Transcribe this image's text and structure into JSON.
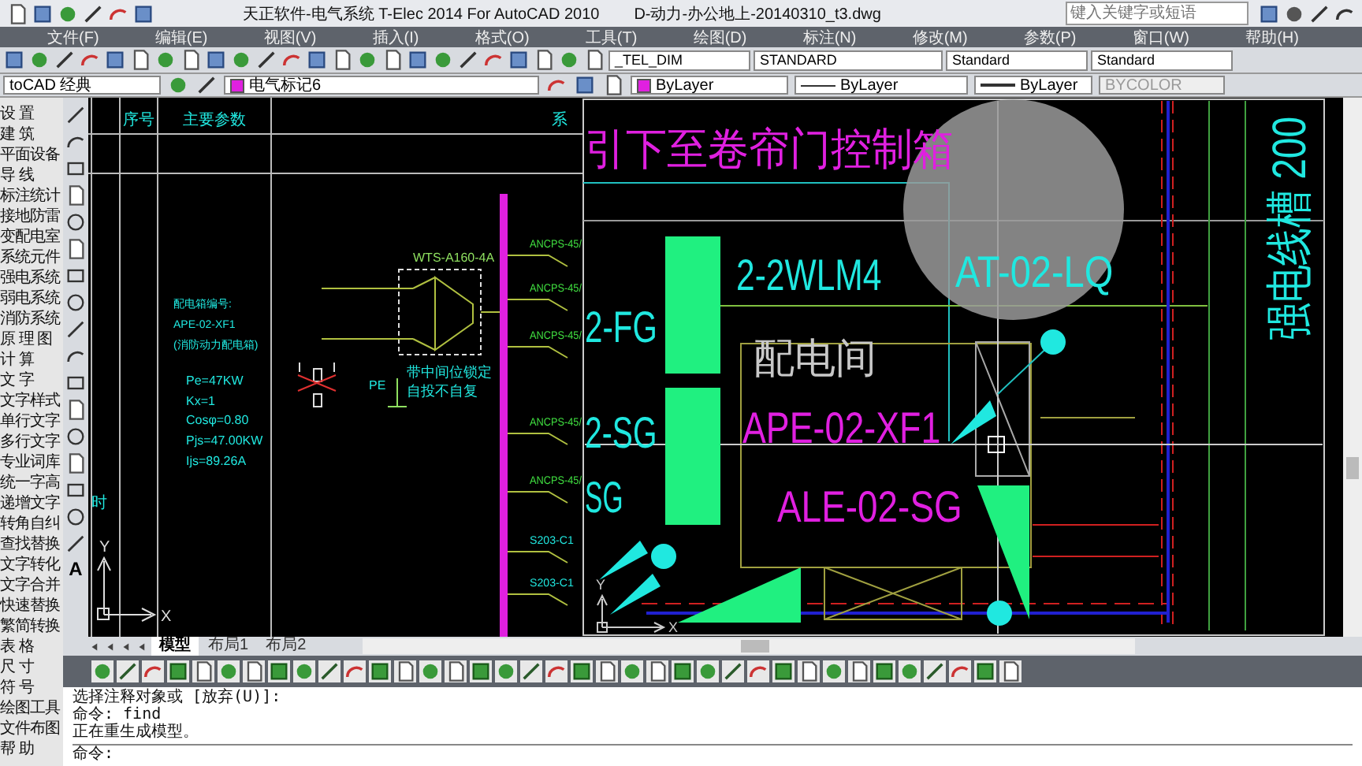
{
  "title_bar": {
    "title": "天正软件-电气系统 T-Elec 2014  For AutoCAD 2010",
    "file": "D-动力-办公地上-20140310_t3.dwg",
    "search": {
      "placeholder": "键入关键字或短语"
    }
  },
  "menu_bar": [
    "文件(F)",
    "编辑(E)",
    "视图(V)",
    "插入(I)",
    "格式(O)",
    "工具(T)",
    "绘图(D)",
    "标注(N)",
    "修改(M)",
    "参数(P)",
    "窗口(W)",
    "帮助(H)"
  ],
  "styles_toolbar": {
    "text_style": "_TEL_DIM",
    "dim_style": "STANDARD",
    "table_style": "Standard",
    "multileader_style": "Standard"
  },
  "properties_bar": {
    "workspace": "toCAD 经典",
    "layer": "电气标记6",
    "color_control": "ByLayer",
    "linetype": "ByLayer",
    "lineweight": "ByLayer",
    "plot_style": "BYCOLOR"
  },
  "side_menu": [
    "设 置",
    "建 筑",
    "平面设备",
    "导 线",
    "标注统计",
    "接地防雷",
    "变配电室",
    "系统元件",
    "强电系统",
    "弱电系统",
    "消防系统",
    "原 理 图",
    "计 算",
    "文 字",
    "文字样式",
    "单行文字",
    "多行文字",
    "专业词库",
    "统一字高",
    "递增文字",
    "转角自纠",
    "查找替换",
    "文字转化",
    "文字合并",
    "快速替换",
    "繁简转换",
    "表 格",
    "尺 寸",
    "符 号",
    "绘图工具",
    "文件布图",
    "帮 助"
  ],
  "draw_tools": {
    "text_tool": "A"
  },
  "drawing": {
    "table_headers": [
      "序号",
      "主要参数",
      "系"
    ],
    "panel_info": [
      "配电箱编号:",
      "APE-02-XF1",
      "(消防动力配电箱)"
    ],
    "params": [
      "Pe=47KW",
      "Kx=1",
      "Cosφ=0.80",
      "Pjs=47.00KW",
      "Ijs=89.26A"
    ],
    "switch_label": "WTS-A160-4A",
    "switch_note": [
      "带中间位锁定",
      "自投不自复"
    ],
    "pe_label": "PE",
    "circuits": [
      "ANCPS-45/",
      "ANCPS-45/",
      "ANCPS-45/",
      "ANCPS-45/",
      "ANCPS-45/",
      "S203-C1",
      "S203-C1"
    ],
    "side_note": "时",
    "ucs_labels": [
      "Y",
      "X"
    ]
  },
  "viewport": {
    "labels": [
      {
        "text": "引下至卷帘门控制箱",
        "kind": "title"
      },
      {
        "text": "2-2WLM4",
        "kind": "cable"
      },
      {
        "text": "AT-02-LQ",
        "kind": "cable"
      },
      {
        "text": "2-FG",
        "kind": "cable"
      },
      {
        "text": "配电间",
        "kind": "room"
      },
      {
        "text": "2-SG",
        "kind": "cable"
      },
      {
        "text": "APE-02-XF1",
        "kind": "panel"
      },
      {
        "text": "SG",
        "kind": "cable"
      },
      {
        "text": "ALE-02-SG",
        "kind": "panel"
      },
      {
        "text": "强电线槽 200",
        "kind": "vertical"
      }
    ],
    "ucs_labels": [
      "Y",
      "X"
    ]
  },
  "layout_tabs": [
    {
      "label": "模型",
      "selected": true
    },
    {
      "label": "布局1",
      "selected": false
    },
    {
      "label": "布局2",
      "selected": false
    }
  ],
  "command_line": {
    "history": [
      "选择注释对象或 [放弃(U)]:",
      "命令: find",
      "正在重生成模型。"
    ],
    "prompt": "命令:"
  }
}
